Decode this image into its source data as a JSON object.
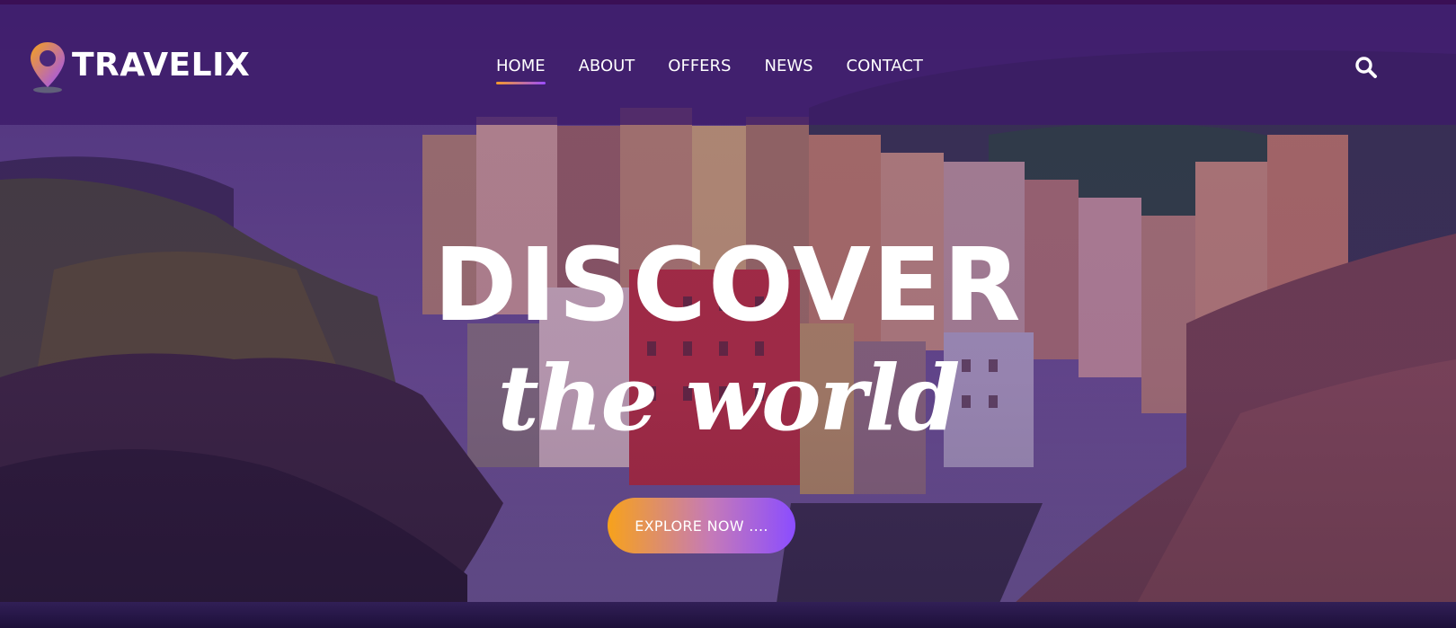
{
  "brand": {
    "name": "TRAVELIX",
    "icon": "map-pin-icon"
  },
  "nav": {
    "items": [
      {
        "label": "HOME",
        "active": true
      },
      {
        "label": "ABOUT",
        "active": false
      },
      {
        "label": "OFFERS",
        "active": false
      },
      {
        "label": "NEWS",
        "active": false
      },
      {
        "label": "CONTACT",
        "active": false
      }
    ]
  },
  "search": {
    "icon": "search-icon"
  },
  "hero": {
    "headline": "DISCOVER",
    "subline": "the world",
    "cta_label": "EXPLORE NOW ...."
  },
  "colors": {
    "header_bg": "#3c1a69",
    "accent_orange": "#f7a21b",
    "accent_purple": "#8b4dff",
    "text": "#ffffff"
  }
}
